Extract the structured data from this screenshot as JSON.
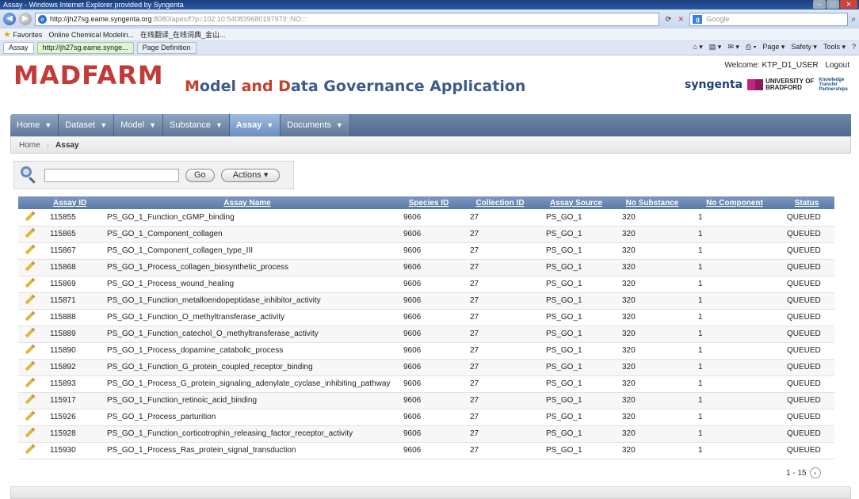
{
  "browser": {
    "title": "Assay - Windows Internet Explorer provided by Syngenta",
    "url_host": "http://jh27sg.eame.syngenta.org",
    "url_path": ":8080/apex/f?p=102:10:540839680197973::NO:::",
    "search_placeholder": "Google",
    "favorites_label": "Favorites",
    "fav_items": [
      "Online Chemical Modelin...",
      "在线翻译_在线词典_金山..."
    ],
    "tabs": [
      "Assay",
      "http://jh27sg.eame.synge...",
      "Page Definition"
    ],
    "toolbar_items": [
      "Page ▾",
      "Safety ▾",
      "Tools ▾"
    ]
  },
  "header": {
    "logo": "MADFARM",
    "app_title_m": "M",
    "app_title_odel": "odel ",
    "app_title_and": "and ",
    "app_title_d": "D",
    "app_title_rest": "ata Governance Application",
    "welcome": "Welcome: KTP_D1_USER",
    "logout": "Logout",
    "partner1": "syngenta",
    "partner2_line1": "UNIVERSITY OF",
    "partner2_line2": "BRADFORD",
    "partner3": [
      "Knowledge",
      "Transfer",
      "Partnerships"
    ]
  },
  "menu": [
    {
      "label": "Home"
    },
    {
      "label": "Dataset"
    },
    {
      "label": "Model"
    },
    {
      "label": "Substance"
    },
    {
      "label": "Assay"
    },
    {
      "label": "Documents"
    }
  ],
  "breadcrumb": {
    "home": "Home",
    "current": "Assay"
  },
  "search": {
    "go": "Go",
    "actions": "Actions"
  },
  "table": {
    "headers": [
      "Assay ID",
      "Assay Name",
      "Species ID",
      "Collection ID",
      "Assay Source",
      "No Substance",
      "No Component",
      "Status"
    ],
    "rows": [
      [
        "115855",
        "PS_GO_1_Function_cGMP_binding",
        "9606",
        "27",
        "PS_GO_1",
        "320",
        "1",
        "QUEUED"
      ],
      [
        "115865",
        "PS_GO_1_Component_collagen",
        "9606",
        "27",
        "PS_GO_1",
        "320",
        "1",
        "QUEUED"
      ],
      [
        "115867",
        "PS_GO_1_Component_collagen_type_III",
        "9606",
        "27",
        "PS_GO_1",
        "320",
        "1",
        "QUEUED"
      ],
      [
        "115868",
        "PS_GO_1_Process_collagen_biosynthetic_process",
        "9606",
        "27",
        "PS_GO_1",
        "320",
        "1",
        "QUEUED"
      ],
      [
        "115869",
        "PS_GO_1_Process_wound_healing",
        "9606",
        "27",
        "PS_GO_1",
        "320",
        "1",
        "QUEUED"
      ],
      [
        "115871",
        "PS_GO_1_Function_metalloendopeptidase_inhibitor_activity",
        "9606",
        "27",
        "PS_GO_1",
        "320",
        "1",
        "QUEUED"
      ],
      [
        "115888",
        "PS_GO_1_Function_O_methyltransferase_activity",
        "9606",
        "27",
        "PS_GO_1",
        "320",
        "1",
        "QUEUED"
      ],
      [
        "115889",
        "PS_GO_1_Function_catechol_O_methyltransferase_activity",
        "9606",
        "27",
        "PS_GO_1",
        "320",
        "1",
        "QUEUED"
      ],
      [
        "115890",
        "PS_GO_1_Process_dopamine_catabolic_process",
        "9606",
        "27",
        "PS_GO_1",
        "320",
        "1",
        "QUEUED"
      ],
      [
        "115892",
        "PS_GO_1_Function_G_protein_coupled_receptor_binding",
        "9606",
        "27",
        "PS_GO_1",
        "320",
        "1",
        "QUEUED"
      ],
      [
        "115893",
        "PS_GO_1_Process_G_protein_signaling_adenylate_cyclase_inhibiting_pathway",
        "9606",
        "27",
        "PS_GO_1",
        "320",
        "1",
        "QUEUED"
      ],
      [
        "115917",
        "PS_GO_1_Function_retinoic_acid_binding",
        "9606",
        "27",
        "PS_GO_1",
        "320",
        "1",
        "QUEUED"
      ],
      [
        "115926",
        "PS_GO_1_Process_parturition",
        "9606",
        "27",
        "PS_GO_1",
        "320",
        "1",
        "QUEUED"
      ],
      [
        "115928",
        "PS_GO_1_Function_corticotrophin_releasing_factor_receptor_activity",
        "9606",
        "27",
        "PS_GO_1",
        "320",
        "1",
        "QUEUED"
      ],
      [
        "115930",
        "PS_GO_1_Process_Ras_protein_signal_transduction",
        "9606",
        "27",
        "PS_GO_1",
        "320",
        "1",
        "QUEUED"
      ]
    ]
  },
  "pagination": {
    "range": "1 - 15"
  }
}
